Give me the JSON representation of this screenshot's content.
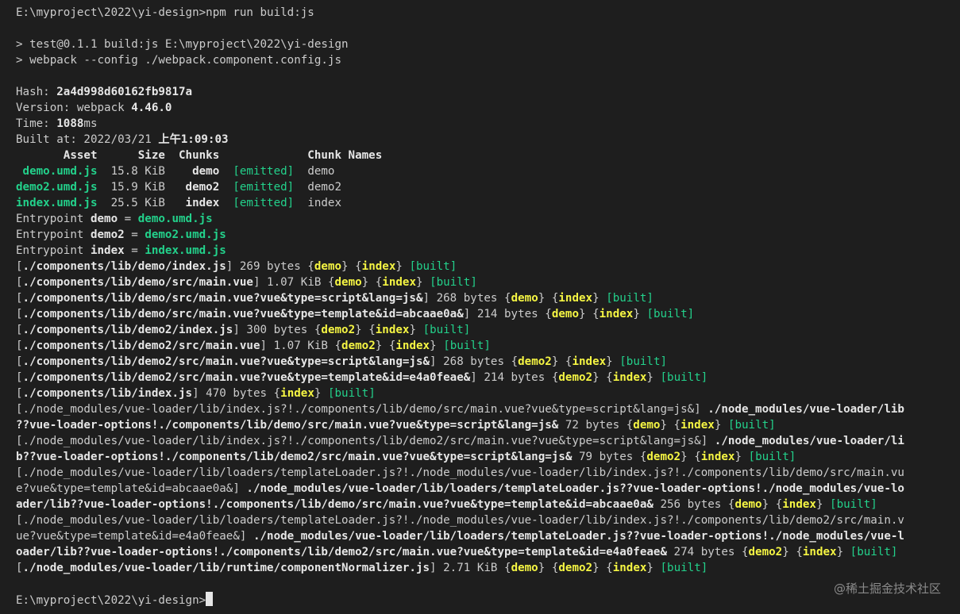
{
  "terminal": {
    "prompt": "E:\\myproject\\2022\\yi-design>",
    "command": "npm run build:js",
    "script_info": [
      "> test@0.1.1 build:js E:\\myproject\\2022\\yi-design",
      "> webpack --config ./webpack.component.config.js"
    ],
    "hash_label": "Hash: ",
    "hash": "2a4d998d60162fb9817a",
    "version_label": "Version: webpack ",
    "version": "4.46.0",
    "time_label": "Time: ",
    "time": "1088",
    "time_unit": "ms",
    "built_label": "Built at: 2022/03/21 ",
    "built_time": "上午1:09:03",
    "asset_header": "       Asset      Size  Chunks             Chunk Names",
    "assets": [
      {
        "asset": " demo.umd.js",
        "size": "  15.8 KiB  ",
        "chunk": "  demo",
        "status": "[emitted]",
        "names": "demo"
      },
      {
        "asset": "demo2.umd.js",
        "size": "  15.9 KiB  ",
        "chunk": " demo2",
        "status": "[emitted]",
        "names": "demo2"
      },
      {
        "asset": "index.umd.js",
        "size": "  25.5 KiB  ",
        "chunk": " index",
        "status": "[emitted]",
        "names": "index"
      }
    ],
    "entrypoints": [
      {
        "label": "Entrypoint ",
        "name": "demo",
        "eq": " = ",
        "file": "demo.umd.js"
      },
      {
        "label": "Entrypoint ",
        "name": "demo2",
        "eq": " = ",
        "file": "demo2.umd.js"
      },
      {
        "label": "Entrypoint ",
        "name": "index",
        "eq": " = ",
        "file": "index.umd.js"
      }
    ],
    "modules": [
      {
        "path": "./components/lib/demo/index.js",
        "size": " 269 bytes ",
        "c1": "demo",
        "c2": "index"
      },
      {
        "path": "./components/lib/demo/src/main.vue",
        "size": " 1.07 KiB ",
        "c1": "demo",
        "c2": "index"
      },
      {
        "path": "./components/lib/demo/src/main.vue?vue&type=script&lang=js&",
        "size": " 268 bytes ",
        "c1": "demo",
        "c2": "index"
      },
      {
        "path": "./components/lib/demo/src/main.vue?vue&type=template&id=abcaae0a&",
        "size": " 214 bytes ",
        "c1": "demo",
        "c2": "index"
      },
      {
        "path": "./components/lib/demo2/index.js",
        "size": " 300 bytes ",
        "c1": "demo2",
        "c2": "index"
      },
      {
        "path": "./components/lib/demo2/src/main.vue",
        "size": " 1.07 KiB ",
        "c1": "demo2",
        "c2": "index"
      },
      {
        "path": "./components/lib/demo2/src/main.vue?vue&type=script&lang=js&",
        "size": " 268 bytes ",
        "c1": "demo2",
        "c2": "index"
      },
      {
        "path": "./components/lib/demo2/src/main.vue?vue&type=template&id=e4a0feae&",
        "size": " 214 bytes ",
        "c1": "demo2",
        "c2": "index"
      },
      {
        "path": "./components/lib/index.js",
        "size": " 470 bytes ",
        "c1": "index"
      }
    ],
    "loader_lines": [
      {
        "n": "[./node_modules/vue-loader/lib/index.js?!./components/lib/demo/src/main.vue?vue&type=script&lang=js&] ",
        "b": "./node_modules/vue-loader/lib"
      },
      {
        "b": "??vue-loader-options!./components/lib/demo/src/main.vue?vue&type=script&lang=js&",
        "size": " 72 bytes ",
        "c1": "demo",
        "c2": "index"
      },
      {
        "n": "[./node_modules/vue-loader/lib/index.js?!./components/lib/demo2/src/main.vue?vue&type=script&lang=js&] ",
        "b": "./node_modules/vue-loader/li"
      },
      {
        "b": "b??vue-loader-options!./components/lib/demo2/src/main.vue?vue&type=script&lang=js&",
        "size": " 79 bytes ",
        "c1": "demo2",
        "c2": "index"
      },
      {
        "n": "[./node_modules/vue-loader/lib/loaders/templateLoader.js?!./node_modules/vue-loader/lib/index.js?!./components/lib/demo/src/main.vu"
      },
      {
        "n": "e?vue&type=template&id=abcaae0a&] ",
        "b": "./node_modules/vue-loader/lib/loaders/templateLoader.js??vue-loader-options!./node_modules/vue-lo"
      },
      {
        "b": "ader/lib??vue-loader-options!./components/lib/demo/src/main.vue?vue&type=template&id=abcaae0a&",
        "size": " 256 bytes ",
        "c1": "demo",
        "c2": "index"
      },
      {
        "n": "[./node_modules/vue-loader/lib/loaders/templateLoader.js?!./node_modules/vue-loader/lib/index.js?!./components/lib/demo2/src/main.v"
      },
      {
        "n": "ue?vue&type=template&id=e4a0feae&] ",
        "b": "./node_modules/vue-loader/lib/loaders/templateLoader.js??vue-loader-options!./node_modules/vue-l"
      },
      {
        "b": "oader/lib??vue-loader-options!./components/lib/demo2/src/main.vue?vue&type=template&id=e4a0feae&",
        "size": " 274 bytes ",
        "c1": "demo2",
        "c2": "index"
      }
    ],
    "normalizer": {
      "path": "./node_modules/vue-loader/lib/runtime/componentNormalizer.js",
      "size": " 2.71 KiB ",
      "c1": "demo",
      "c2": "demo2",
      "c3": "index"
    },
    "built_tag": "[built]",
    "watermark": "@稀土掘金技术社区"
  },
  "colors": {
    "background": "#1e1e1e",
    "text": "#cccccc",
    "green": "#23d18b",
    "yellow": "#f5f543"
  }
}
